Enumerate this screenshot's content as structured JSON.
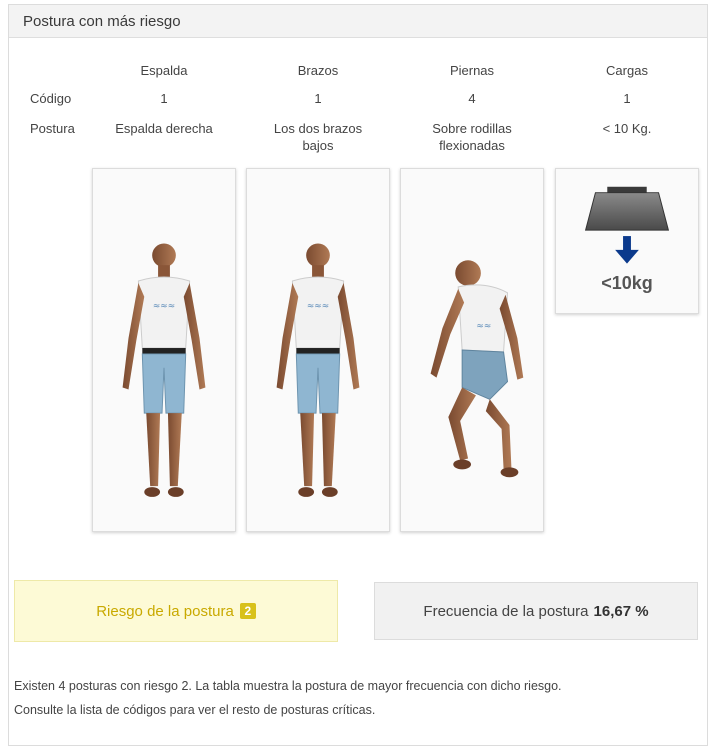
{
  "panel": {
    "title": "Postura con más riesgo"
  },
  "table": {
    "columns": [
      "Espalda",
      "Brazos",
      "Piernas",
      "Cargas"
    ],
    "row_labels": {
      "codigo": "Código",
      "postura": "Postura"
    },
    "codes": [
      "1",
      "1",
      "4",
      "1"
    ],
    "postures": [
      [
        "Espalda derecha"
      ],
      [
        "Los dos brazos",
        "bajos"
      ],
      [
        "Sobre rodillas",
        "flexionadas"
      ],
      [
        "< 10 Kg."
      ]
    ]
  },
  "images": {
    "figures": [
      "standing-person",
      "standing-person",
      "knees-bent-person"
    ],
    "load_label": "<10kg"
  },
  "risk": {
    "label": "Riesgo de la postura",
    "level": "2",
    "color": "#d8c11a"
  },
  "frequency": {
    "label": "Frecuencia de la postura",
    "value": "16,67 %"
  },
  "note": {
    "line1": "Existen 4 posturas con riesgo 2. La tabla muestra la postura de mayor frecuencia con dicho riesgo.",
    "line2": "Consulte la lista de códigos para ver el resto de posturas críticas."
  }
}
